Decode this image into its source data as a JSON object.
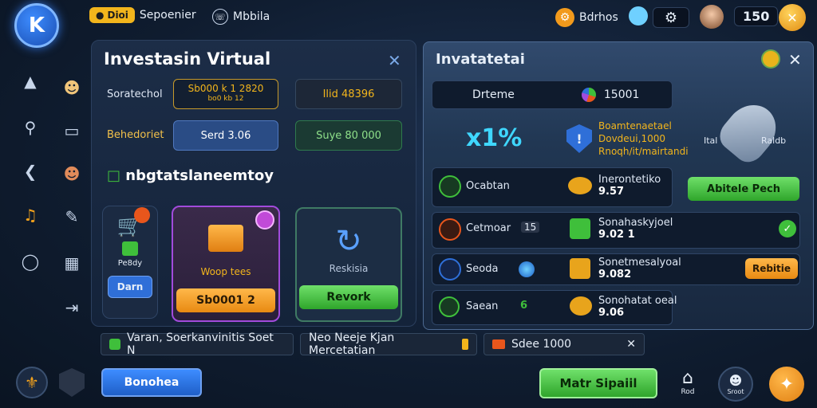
{
  "top_bar": {
    "logo_letter": "K",
    "badge_label": "Dioi",
    "mode_label": "Sepoenier",
    "mobile_label": "Mbbila",
    "events_label": "Bdrhos",
    "level_value": "150"
  },
  "sidebar": {
    "icons": [
      "graduation-cap-icon",
      "search-icon",
      "back-arrow-icon",
      "music-note-icon",
      "power-icon"
    ]
  },
  "left_panel": {
    "title": "Investasin Virtual",
    "row1_label": "Soratechol",
    "row1_field1": "Sb000 k 1 2820",
    "row1_field1_sub": "bo0 kb 12",
    "row1_field2": "Ilid 48396",
    "row2_label": "Behedoriet",
    "row2_field1": "Serd 3.06",
    "row2_field2": "Suye 80 000",
    "section_title": "nbgtatslaneemtoy",
    "card1_label": "Pe8dy",
    "card1_button": "Darn",
    "card2_label": "Woop tees",
    "card2_button": "Sb0001 2",
    "card3_label": "Reskisia",
    "card3_button": "Revork"
  },
  "right_panel": {
    "title": "Invatatetai",
    "row1_label": "Drteme",
    "row1_value": "15001",
    "percent": "x1%",
    "warning_line1": "Boamtenaetael",
    "warning_line2": "Dovdeui,1000",
    "warning_line3": "Rnoqh/it/mairtandi",
    "rocket_label_left": "Ital",
    "rocket_label_right": "Raldb",
    "rows": [
      {
        "label": "Ocabtan",
        "item_label": "Inerontetiko",
        "item_value": "9.57",
        "extra": "",
        "action": "Abitele Pech"
      },
      {
        "label": "Cetmoar",
        "extra": "15",
        "item_label": "Sonahaskyjoel",
        "item_value": "9.02",
        "extra2": "1",
        "action": ""
      },
      {
        "label": "Seoda",
        "item_label": "Sonetmesalyoal",
        "item_value": "9.082",
        "extra": "",
        "action": "Rebitie"
      },
      {
        "label": "Saean",
        "extra": "6",
        "item_label": "Sonohatat oeal",
        "item_value": "9.06",
        "extra2": "",
        "action": ""
      }
    ]
  },
  "bottom_tags": [
    "Varan, Soerkanvinitis Soet N",
    "Neo Neeje Kjan Mercetatian",
    "Sdee 1000"
  ],
  "bottom_bar": {
    "left_button": "Bonohea",
    "main_button": "Matr Sipaiil",
    "nav1_label": "Rod",
    "nav2_label": "Sroot"
  },
  "colors": {
    "accent_blue": "#2f6fd8",
    "orange": "#f29a1c",
    "green": "#3fbf3b",
    "purple": "#a24bdc"
  }
}
